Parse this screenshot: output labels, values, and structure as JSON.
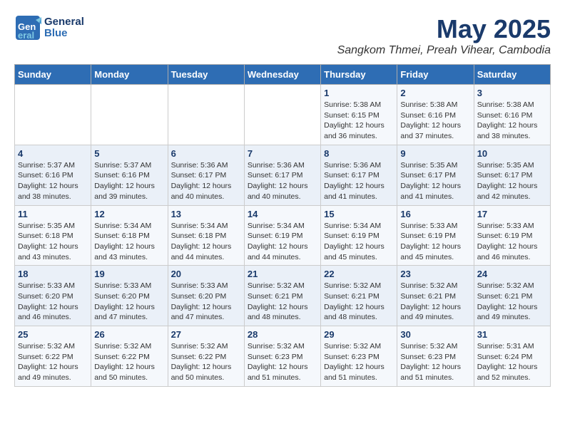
{
  "logo": {
    "line1": "General",
    "line2": "Blue"
  },
  "title": "May 2025",
  "subtitle": "Sangkom Thmei, Preah Vihear, Cambodia",
  "weekdays": [
    "Sunday",
    "Monday",
    "Tuesday",
    "Wednesday",
    "Thursday",
    "Friday",
    "Saturday"
  ],
  "weeks": [
    [
      {
        "day": "",
        "info": ""
      },
      {
        "day": "",
        "info": ""
      },
      {
        "day": "",
        "info": ""
      },
      {
        "day": "",
        "info": ""
      },
      {
        "day": "1",
        "info": "Sunrise: 5:38 AM\nSunset: 6:15 PM\nDaylight: 12 hours\nand 36 minutes."
      },
      {
        "day": "2",
        "info": "Sunrise: 5:38 AM\nSunset: 6:16 PM\nDaylight: 12 hours\nand 37 minutes."
      },
      {
        "day": "3",
        "info": "Sunrise: 5:38 AM\nSunset: 6:16 PM\nDaylight: 12 hours\nand 38 minutes."
      }
    ],
    [
      {
        "day": "4",
        "info": "Sunrise: 5:37 AM\nSunset: 6:16 PM\nDaylight: 12 hours\nand 38 minutes."
      },
      {
        "day": "5",
        "info": "Sunrise: 5:37 AM\nSunset: 6:16 PM\nDaylight: 12 hours\nand 39 minutes."
      },
      {
        "day": "6",
        "info": "Sunrise: 5:36 AM\nSunset: 6:17 PM\nDaylight: 12 hours\nand 40 minutes."
      },
      {
        "day": "7",
        "info": "Sunrise: 5:36 AM\nSunset: 6:17 PM\nDaylight: 12 hours\nand 40 minutes."
      },
      {
        "day": "8",
        "info": "Sunrise: 5:36 AM\nSunset: 6:17 PM\nDaylight: 12 hours\nand 41 minutes."
      },
      {
        "day": "9",
        "info": "Sunrise: 5:35 AM\nSunset: 6:17 PM\nDaylight: 12 hours\nand 41 minutes."
      },
      {
        "day": "10",
        "info": "Sunrise: 5:35 AM\nSunset: 6:17 PM\nDaylight: 12 hours\nand 42 minutes."
      }
    ],
    [
      {
        "day": "11",
        "info": "Sunrise: 5:35 AM\nSunset: 6:18 PM\nDaylight: 12 hours\nand 43 minutes."
      },
      {
        "day": "12",
        "info": "Sunrise: 5:34 AM\nSunset: 6:18 PM\nDaylight: 12 hours\nand 43 minutes."
      },
      {
        "day": "13",
        "info": "Sunrise: 5:34 AM\nSunset: 6:18 PM\nDaylight: 12 hours\nand 44 minutes."
      },
      {
        "day": "14",
        "info": "Sunrise: 5:34 AM\nSunset: 6:19 PM\nDaylight: 12 hours\nand 44 minutes."
      },
      {
        "day": "15",
        "info": "Sunrise: 5:34 AM\nSunset: 6:19 PM\nDaylight: 12 hours\nand 45 minutes."
      },
      {
        "day": "16",
        "info": "Sunrise: 5:33 AM\nSunset: 6:19 PM\nDaylight: 12 hours\nand 45 minutes."
      },
      {
        "day": "17",
        "info": "Sunrise: 5:33 AM\nSunset: 6:19 PM\nDaylight: 12 hours\nand 46 minutes."
      }
    ],
    [
      {
        "day": "18",
        "info": "Sunrise: 5:33 AM\nSunset: 6:20 PM\nDaylight: 12 hours\nand 46 minutes."
      },
      {
        "day": "19",
        "info": "Sunrise: 5:33 AM\nSunset: 6:20 PM\nDaylight: 12 hours\nand 47 minutes."
      },
      {
        "day": "20",
        "info": "Sunrise: 5:33 AM\nSunset: 6:20 PM\nDaylight: 12 hours\nand 47 minutes."
      },
      {
        "day": "21",
        "info": "Sunrise: 5:32 AM\nSunset: 6:21 PM\nDaylight: 12 hours\nand 48 minutes."
      },
      {
        "day": "22",
        "info": "Sunrise: 5:32 AM\nSunset: 6:21 PM\nDaylight: 12 hours\nand 48 minutes."
      },
      {
        "day": "23",
        "info": "Sunrise: 5:32 AM\nSunset: 6:21 PM\nDaylight: 12 hours\nand 49 minutes."
      },
      {
        "day": "24",
        "info": "Sunrise: 5:32 AM\nSunset: 6:21 PM\nDaylight: 12 hours\nand 49 minutes."
      }
    ],
    [
      {
        "day": "25",
        "info": "Sunrise: 5:32 AM\nSunset: 6:22 PM\nDaylight: 12 hours\nand 49 minutes."
      },
      {
        "day": "26",
        "info": "Sunrise: 5:32 AM\nSunset: 6:22 PM\nDaylight: 12 hours\nand 50 minutes."
      },
      {
        "day": "27",
        "info": "Sunrise: 5:32 AM\nSunset: 6:22 PM\nDaylight: 12 hours\nand 50 minutes."
      },
      {
        "day": "28",
        "info": "Sunrise: 5:32 AM\nSunset: 6:23 PM\nDaylight: 12 hours\nand 51 minutes."
      },
      {
        "day": "29",
        "info": "Sunrise: 5:32 AM\nSunset: 6:23 PM\nDaylight: 12 hours\nand 51 minutes."
      },
      {
        "day": "30",
        "info": "Sunrise: 5:32 AM\nSunset: 6:23 PM\nDaylight: 12 hours\nand 51 minutes."
      },
      {
        "day": "31",
        "info": "Sunrise: 5:31 AM\nSunset: 6:24 PM\nDaylight: 12 hours\nand 52 minutes."
      }
    ]
  ]
}
